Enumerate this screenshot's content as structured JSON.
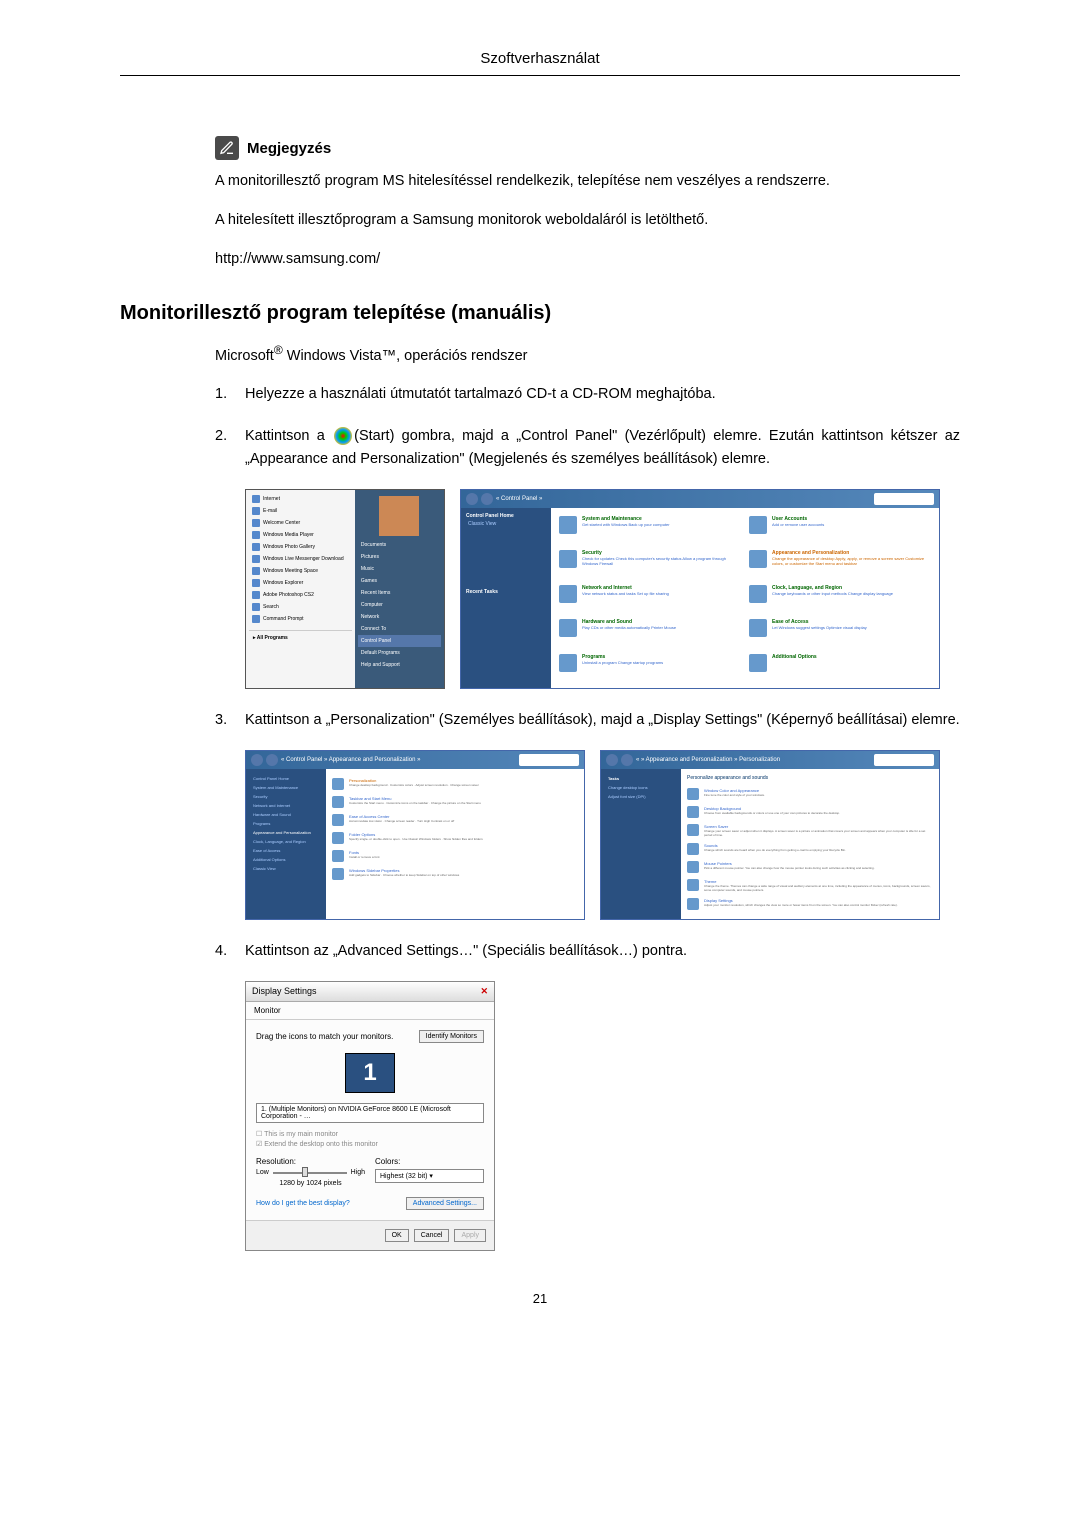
{
  "header": {
    "title": "Szoftverhasználat"
  },
  "note": {
    "title": "Megjegyzés",
    "p1": "A monitorillesztő program MS hitelesítéssel rendelkezik, telepítése nem veszélyes a rendszerre.",
    "p2": "A hitelesített illesztőprogram a Samsung monitorok weboldaláról is letölthető.",
    "p3": "http://www.samsung.com/"
  },
  "section": {
    "heading": "Monitorillesztő program telepítése (manuális)",
    "subtext_prefix": "Microsoft",
    "subtext_suffix": " Windows Vista™, operációs rendszer"
  },
  "steps": {
    "s1": "Helyezze a használati útmutatót tartalmazó CD-t a CD-ROM meghajtóba.",
    "s2a": "Kattintson a ",
    "s2b": "(Start) gombra, majd a „Control Panel\" (Vezérlőpult) elemre. Ezután kattintson kétszer az „Appearance and Personalization\" (Megjelenés és személyes beállítások) elemre.",
    "s3": "Kattintson a „Personalization\" (Személyes beállítások), majd a „Display Settings\" (Képernyő beállításai) elemre.",
    "s4": "Kattintson az „Advanced Settings…\" (Speciális beállítások…) pontra."
  },
  "start_menu": {
    "items": [
      "Internet",
      "E-mail",
      "Welcome Center",
      "Windows Media Player",
      "Windows Photo Gallery",
      "Windows Live Messenger Download",
      "Windows Meeting Space",
      "Windows Explorer",
      "Adobe Photoshop CS2",
      "Search",
      "Command Prompt"
    ],
    "all_programs": "All Programs",
    "right": [
      "Documents",
      "Pictures",
      "Music",
      "Games",
      "Recent Items",
      "Computer",
      "Network",
      "Connect To",
      "Control Panel",
      "Default Programs",
      "Help and Support"
    ]
  },
  "control_panel": {
    "breadcrumb": "« Control Panel »",
    "sidebar_heading": "Control Panel Home",
    "sidebar_item": "Classic View",
    "recent": "Recent Tasks",
    "categories": [
      {
        "title": "System and Maintenance",
        "sub": "Get started with Windows\nBack up your computer"
      },
      {
        "title": "User Accounts",
        "sub": "Add or remove user accounts"
      },
      {
        "title": "Security",
        "sub": "Check for updates\nCheck this computer's security status\nAllow a program through Windows Firewall"
      },
      {
        "title": "Appearance and Personalization",
        "sub": "Change the appearance of desktop\nApply, apply, or remove a screen saver\nCustomize colors, or customize the Start menu and taskbar"
      },
      {
        "title": "Network and Internet",
        "sub": "View network status and tasks\nSet up file sharing"
      },
      {
        "title": "Clock, Language, and Region",
        "sub": "Change keyboards or other input methods\nChange display language"
      },
      {
        "title": "Hardware and Sound",
        "sub": "Play CDs or other media automatically\nPrinter\nMouse"
      },
      {
        "title": "Ease of Access",
        "sub": "Let Windows suggest settings\nOptimize visual display"
      },
      {
        "title": "Programs",
        "sub": "Uninstall a program\nChange startup programs"
      },
      {
        "title": "Additional Options",
        "sub": ""
      }
    ]
  },
  "personalization": {
    "breadcrumb": "« Control Panel » Appearance and Personalization »",
    "title": "Personalize appearance and sounds",
    "left_sidebar": [
      "Control Panel Home",
      "System and Maintenance",
      "Security",
      "Network and Internet",
      "Hardware and Sound",
      "Programs",
      "Appearance and Personalization",
      "Clock, Language, and Region",
      "Ease of Access",
      "Additional Options",
      "Classic View"
    ],
    "left_items": [
      {
        "title": "Personalization",
        "desc": "Change desktop background · Customize colors · Adjust screen resolution · Change screen saver"
      },
      {
        "title": "Taskbar and Start Menu",
        "desc": "Customize the Start menu · Customize icons on the taskbar · Change the picture on the Start menu"
      },
      {
        "title": "Ease of Access Center",
        "desc": "Accommodate low vision · Change screen reader · Turn High Contrast on or off"
      },
      {
        "title": "Folder Options",
        "desc": "Specify single- or double-click to open · Use Classic Windows folders · Show hidden files and folders"
      },
      {
        "title": "Fonts",
        "desc": "Install or remove a font"
      },
      {
        "title": "Windows Sidebar Properties",
        "desc": "Add gadgets to Sidebar · Choose whether to keep Sidebar on top of other windows"
      }
    ],
    "right_sidebar": [
      "Tasks",
      "Change desktop icons",
      "Adjust font size (DPI)"
    ],
    "right_items": [
      {
        "title": "Window Color and Appearance",
        "desc": "Fine tune the color and style of your windows."
      },
      {
        "title": "Desktop Background",
        "desc": "Choose from available backgrounds or colors or use one of your own pictures to decorate the desktop."
      },
      {
        "title": "Screen Saver",
        "desc": "Change your screen saver or adjust when it displays. A screen saver is a picture or animation that covers your screen and appears when your computer is idle for a set period of time."
      },
      {
        "title": "Sounds",
        "desc": "Change which sounds are heard when you do everything from getting e-mail to emptying your Recycle Bin."
      },
      {
        "title": "Mouse Pointers",
        "desc": "Pick a different mouse pointer. You can also change how the mouse pointer looks during such activities as clicking and selecting."
      },
      {
        "title": "Theme",
        "desc": "Change the theme. Themes can change a wide range of visual and auditory elements at one time, including the appearance of menus, icons, backgrounds, screen savers, some computer sounds, and mouse pointers."
      },
      {
        "title": "Display Settings",
        "desc": "Adjust your monitor resolution, which changes the view so more or fewer items fit on the screen. You can also control monitor flicker (refresh rate)."
      }
    ]
  },
  "display_settings": {
    "title": "Display Settings",
    "tab": "Monitor",
    "instruction": "Drag the icons to match your monitors.",
    "identify_btn": "Identify Monitors",
    "monitor_num": "1",
    "dropdown": "1. (Multiple Monitors) on NVIDIA GeForce 8600 LE (Microsoft Corporation - …",
    "check1": "This is my main monitor",
    "check2": "Extend the desktop onto this monitor",
    "resolution_label": "Resolution:",
    "low": "Low",
    "high": "High",
    "resolution": "1280 by 1024 pixels",
    "colors_label": "Colors:",
    "colors": "Highest (32 bit)",
    "link": "How do I get the best display?",
    "adv_btn": "Advanced Settings...",
    "ok": "OK",
    "cancel": "Cancel",
    "apply": "Apply"
  },
  "page_number": "21"
}
